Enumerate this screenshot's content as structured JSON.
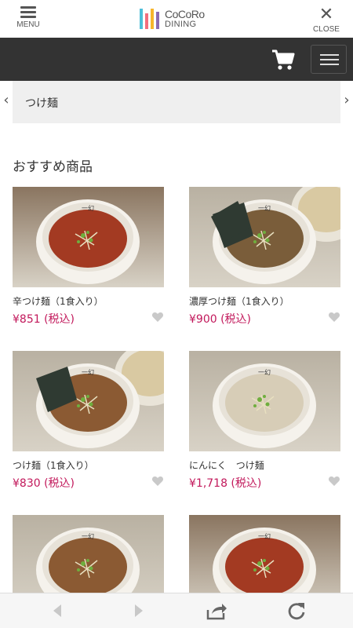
{
  "header": {
    "menu_label": "MENU",
    "close_label": "CLOSE",
    "logo_line1": "CoCoRo",
    "logo_line2": "DINING",
    "logo_colors": [
      "#4dbfd9",
      "#f26d7d",
      "#f7b52c",
      "#8c6bb1"
    ]
  },
  "category": {
    "label": "つけ麺"
  },
  "section": {
    "title": "おすすめ商品"
  },
  "products": [
    {
      "name": "辛つけ麺（1食入り）",
      "price": "¥851 (税込)",
      "image": "spicy-tsukemen-soup"
    },
    {
      "name": "濃厚つけ麺（1食入り）",
      "price": "¥900 (税込)",
      "image": "rich-tsukemen-soup-with-nori"
    },
    {
      "name": "つけ麺（1食入り）",
      "price": "¥830 (税込)",
      "image": "tsukemen-soup-with-nori"
    },
    {
      "name": "にんにく　つけ麺",
      "price": "¥1,718 (税込)",
      "image": "garlic-tsukemen-soup"
    },
    {
      "name": "",
      "price": "",
      "image": "tsukemen-soup"
    },
    {
      "name": "",
      "price": "",
      "image": "spicy-tsukemen-soup"
    }
  ],
  "colors": {
    "accent_price": "#c2185b",
    "dark_bar": "#333333"
  }
}
